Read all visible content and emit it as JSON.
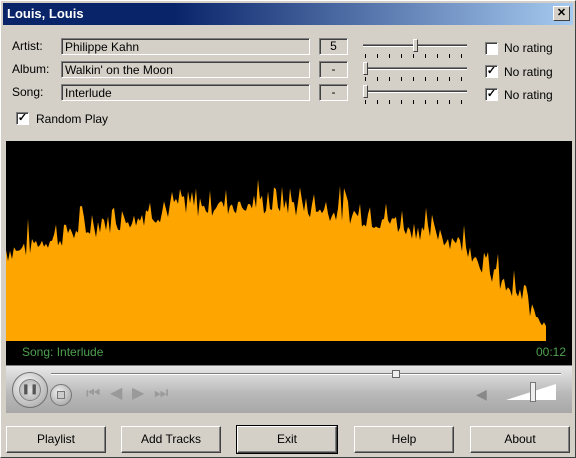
{
  "window": {
    "title": "Louis, Louis",
    "close_label": "✕"
  },
  "track": {
    "artist_label": "Artist:",
    "artist": "Philippe Kahn",
    "artist_rating": "5",
    "album_label": "Album:",
    "album": "Walkin' on the Moon",
    "album_rating": "-",
    "song_label": "Song:",
    "song": "Interlude",
    "song_rating": "-"
  },
  "ratings": {
    "no_rating_label": "No rating",
    "artist_no_rating": false,
    "album_no_rating": true,
    "song_no_rating": true,
    "artist_level": 0.5,
    "album_level": 0.0,
    "song_level": 0.0
  },
  "random_play": {
    "label": "Random Play",
    "checked": true
  },
  "status": {
    "song_text": "Song: Interlude",
    "time": "00:12"
  },
  "transport": {
    "seek_position": 0.68,
    "volume_level": 0.55
  },
  "colors": {
    "visualizer": "#ffa500",
    "status_text": "#4ea04e"
  },
  "buttons": {
    "playlist": "Playlist",
    "add_tracks": "Add Tracks",
    "exit": "Exit",
    "help": "Help",
    "about": "About"
  }
}
